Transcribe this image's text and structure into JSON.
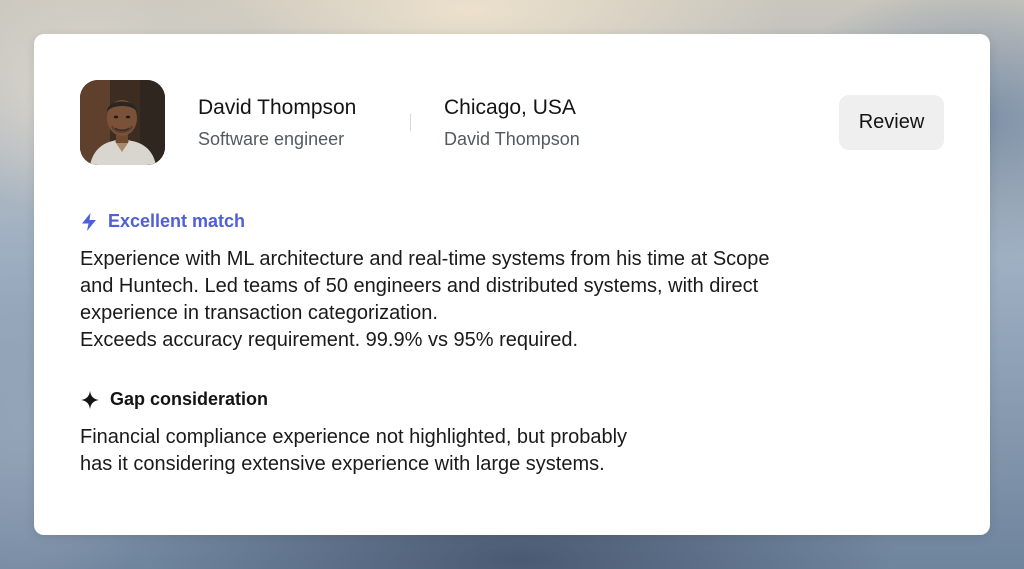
{
  "candidate": {
    "name": "David Thompson",
    "role": "Software engineer",
    "location": "Chicago, USA",
    "location_subtitle": "David Thompson",
    "avatar_icon": "candidate-photo"
  },
  "actions": {
    "review_label": "Review"
  },
  "match": {
    "icon": "lightning-bolt-icon",
    "heading": "Excellent match",
    "color": "#4f5fd6",
    "lines": [
      "Experience with ML architecture and real-time systems from his time at Scope",
      "and Huntech. Led teams of 50 engineers and distributed systems, with direct",
      "experience in transaction categorization.",
      "Exceeds accuracy requirement. 99.9% vs 95% required."
    ]
  },
  "gap": {
    "icon": "sparkle-icon",
    "heading": "Gap consideration",
    "lines": [
      "Financial compliance experience not highlighted, but probably",
      "has it considering extensive experience with large systems."
    ]
  }
}
